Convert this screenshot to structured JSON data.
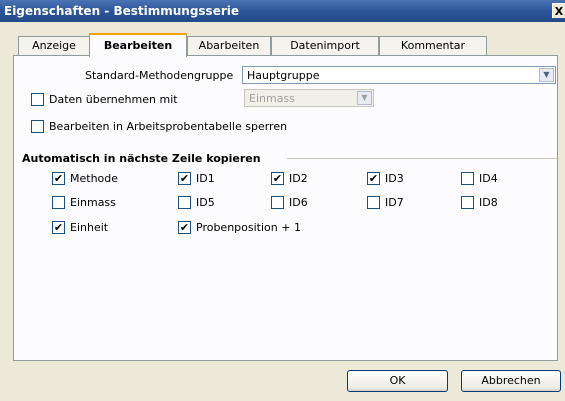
{
  "window": {
    "title": "Eigenschaften - Bestimmungsserie",
    "close_label": "X"
  },
  "tabs": [
    {
      "label": "Anzeige",
      "active": false
    },
    {
      "label": "Bearbeiten",
      "active": true
    },
    {
      "label": "Abarbeiten",
      "active": false
    },
    {
      "label": "Datenimport",
      "active": false
    },
    {
      "label": "Kommentar",
      "active": false
    }
  ],
  "form": {
    "method_group_label": "Standard-Methodengruppe",
    "method_group_value": "Hauptgruppe",
    "take_data_label": "Daten übernehmen mit",
    "take_data_checked": false,
    "take_data_value": "Einmass",
    "lock_label": "Bearbeiten in Arbeitsprobentabelle sperren",
    "lock_checked": false
  },
  "copy_section": {
    "title": "Automatisch in nächste Zeile kopieren",
    "items": [
      {
        "label": "Methode",
        "checked": true
      },
      {
        "label": "ID1",
        "checked": true
      },
      {
        "label": "ID2",
        "checked": true
      },
      {
        "label": "ID3",
        "checked": true
      },
      {
        "label": "ID4",
        "checked": false
      },
      {
        "label": "Einmass",
        "checked": false
      },
      {
        "label": "ID5",
        "checked": false
      },
      {
        "label": "ID6",
        "checked": false
      },
      {
        "label": "ID7",
        "checked": false
      },
      {
        "label": "ID8",
        "checked": false
      },
      {
        "label": "Einheit",
        "checked": true
      },
      {
        "label": "Probenposition + 1",
        "checked": true
      }
    ]
  },
  "buttons": {
    "ok": "OK",
    "cancel": "Abbrechen"
  },
  "icons": {
    "close": "close-icon",
    "dropdown": "chevron-down-icon",
    "check": "checkmark-icon"
  }
}
